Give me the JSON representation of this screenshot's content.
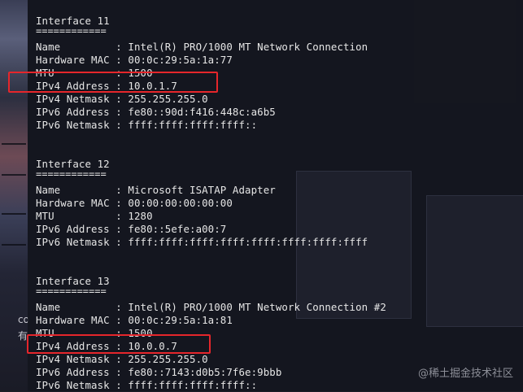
{
  "wallpaper": {
    "labels": [
      "co",
      "有"
    ]
  },
  "interfaces": [
    {
      "header": "Interface 11",
      "underline": "============",
      "rows": [
        {
          "key": "Name        ",
          "value": "Intel(R) PRO/1000 MT Network Connection"
        },
        {
          "key": "Hardware MAC",
          "value": "00:0c:29:5a:1a:77"
        },
        {
          "key": "MTU         ",
          "value": "1500"
        },
        {
          "key": "IPv4 Address",
          "value": "10.0.1.7"
        },
        {
          "key": "IPv4 Netmask",
          "value": "255.255.255.0"
        },
        {
          "key": "IPv6 Address",
          "value": "fe80::90d:f416:448c:a6b5"
        },
        {
          "key": "IPv6 Netmask",
          "value": "ffff:ffff:ffff:ffff::"
        }
      ]
    },
    {
      "header": "Interface 12",
      "underline": "============",
      "rows": [
        {
          "key": "Name        ",
          "value": "Microsoft ISATAP Adapter"
        },
        {
          "key": "Hardware MAC",
          "value": "00:00:00:00:00:00"
        },
        {
          "key": "MTU         ",
          "value": "1280"
        },
        {
          "key": "IPv6 Address",
          "value": "fe80::5efe:a00:7"
        },
        {
          "key": "IPv6 Netmask",
          "value": "ffff:ffff:ffff:ffff:ffff:ffff:ffff:ffff"
        }
      ]
    },
    {
      "header": "Interface 13",
      "underline": "============",
      "rows": [
        {
          "key": "Name        ",
          "value": "Intel(R) PRO/1000 MT Network Connection #2"
        },
        {
          "key": "Hardware MAC",
          "value": "00:0c:29:5a:1a:81"
        },
        {
          "key": "MTU         ",
          "value": "1500"
        },
        {
          "key": "IPv4 Address",
          "value": "10.0.0.7"
        },
        {
          "key": "IPv4 Netmask",
          "value": "255.255.255.0"
        },
        {
          "key": "IPv6 Address",
          "value": "fe80::7143:d0b5:7f6e:9bbb"
        },
        {
          "key": "IPv6 Netmask",
          "value": "ffff:ffff:ffff:ffff::"
        }
      ]
    }
  ],
  "highlight_color": "#e5262b",
  "watermark": "@稀土掘金技术社区"
}
